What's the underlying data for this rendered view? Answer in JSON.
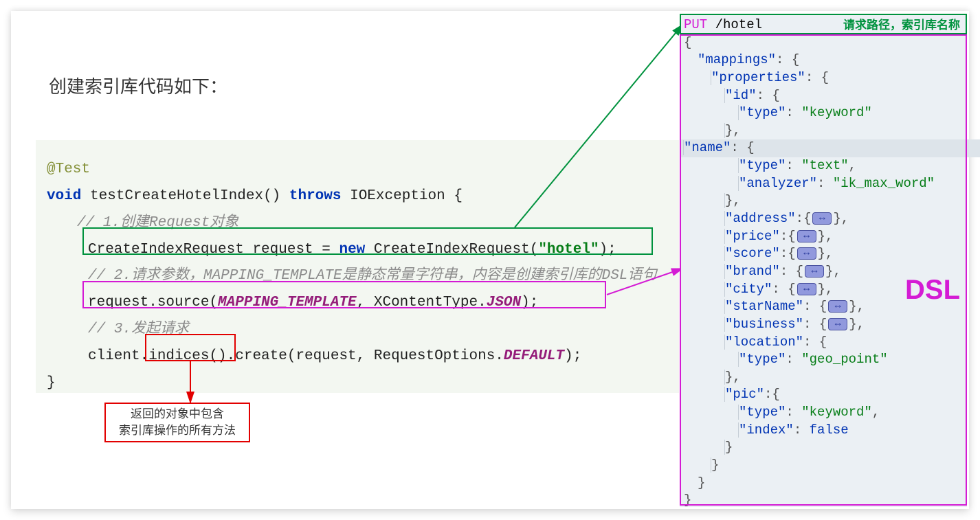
{
  "title": "创建索引库代码如下：",
  "code": {
    "annotation": "@Test",
    "void": "void",
    "method_name": " testCreateHotelIndex() ",
    "throws": "throws",
    "exception": " IOException {",
    "comment1": "// 1.创建Request对象",
    "line1_a": "CreateIndexRequest request = ",
    "new": "new",
    "line1_b": " CreateIndexRequest(",
    "line1_str": "\"hotel\"",
    "line1_c": ");",
    "comment2": "// 2.请求参数，MAPPING_TEMPLATE是静态常量字符串，内容是创建索引库的DSL语句",
    "line2_a": "request.source(",
    "line2_const": "MAPPING_TEMPLATE",
    "line2_b": ", XContentType.",
    "line2_json": "JSON",
    "line2_c": ");",
    "comment3": "// 3.发起请求",
    "line3_a": "client.indices().create(request, RequestOptions.",
    "line3_const": "DEFAULT",
    "line3_b": ");",
    "close": "}"
  },
  "annotation_box": {
    "line1": "返回的对象中包含",
    "line2": "索引库操作的所有方法"
  },
  "dsl": {
    "method": "PUT",
    "path": " /hotel",
    "path_label": "请求路径，索引库名称",
    "label": "DSL",
    "open": "{",
    "mappings_key": "\"mappings\"",
    "mappings_open": ": {",
    "properties_key": "\"properties\"",
    "properties_open": ": {",
    "id_key": "\"id\"",
    "id_open": ": {",
    "id_type_key": "\"type\"",
    "id_type_val": "\"keyword\"",
    "name_key": "\"name\"",
    "name_open": ": {",
    "name_type_key": "\"type\"",
    "name_type_val": "\"text\"",
    "name_analyzer_key": "\"analyzer\"",
    "name_analyzer_val": "\"ik_max_word\"",
    "address_key": "\"address\"",
    "price_key": "\"price\"",
    "score_key": "\"score\"",
    "brand_key": "\"brand\"",
    "city_key": "\"city\"",
    "starName_key": "\"starName\"",
    "business_key": "\"business\"",
    "location_key": "\"location\"",
    "location_open": ": {",
    "location_type_key": "\"type\"",
    "location_type_val": "\"geo_point\"",
    "pic_key": "\"pic\"",
    "pic_open": ":{",
    "pic_type_key": "\"type\"",
    "pic_type_val": "\"keyword\"",
    "pic_index_key": "\"index\"",
    "pic_index_val": "false",
    "close_obj": "},",
    "close_props": "}",
    "close_map": "}",
    "close": "}"
  }
}
